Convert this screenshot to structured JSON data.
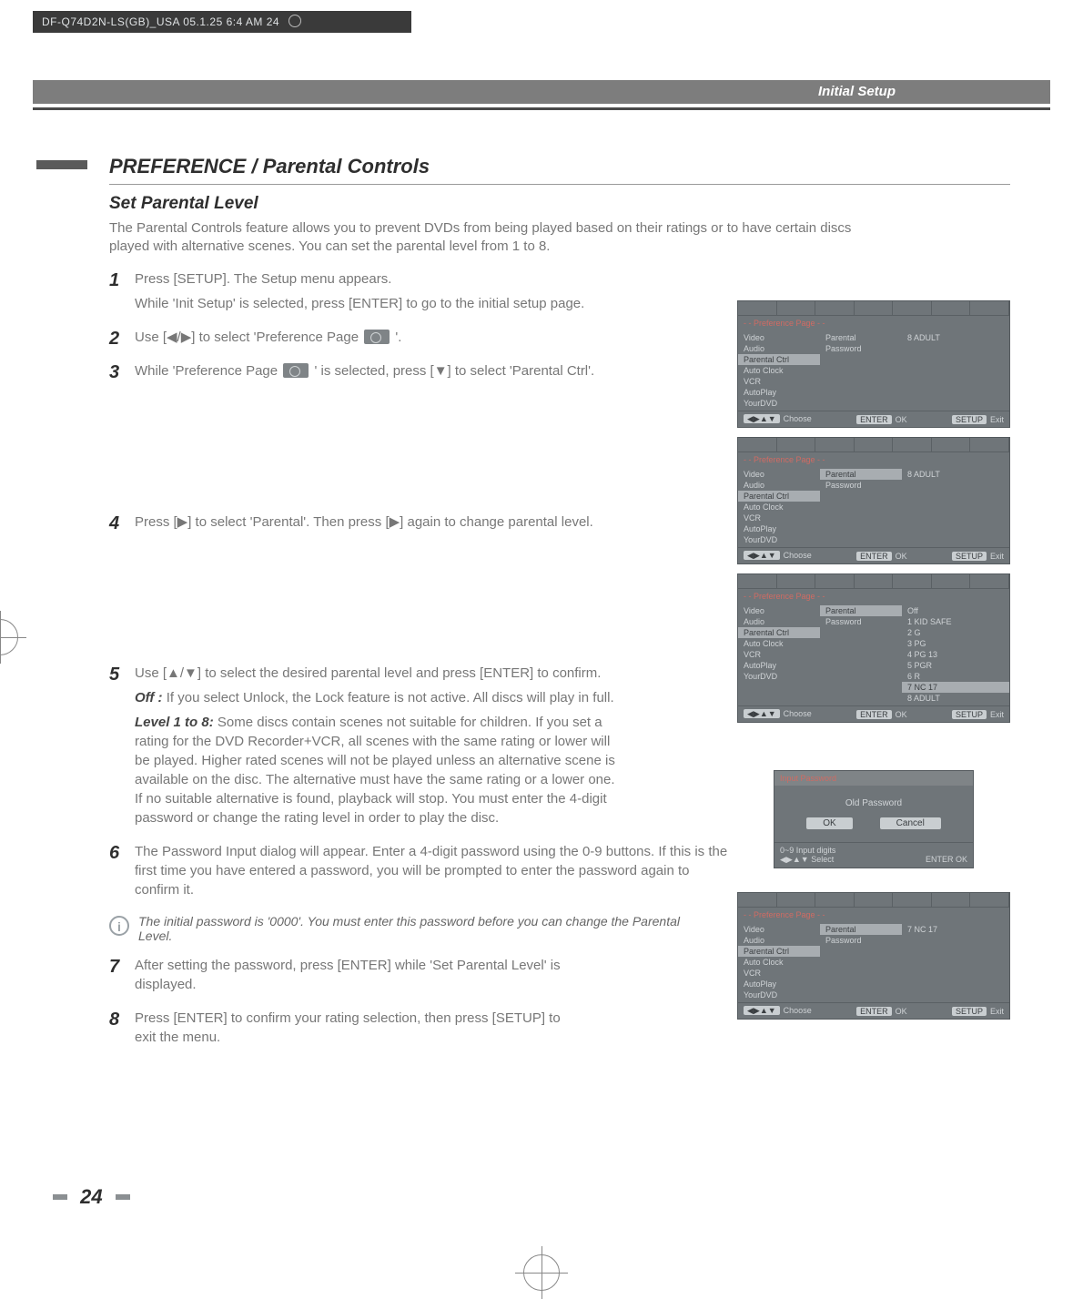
{
  "print_header": "DF-Q74D2N-LS(GB)_USA  05.1.25 6:4 AM      24",
  "section_label": "Initial Setup",
  "page_title": "PREFERENCE / Parental Controls",
  "subhead": "Set Parental Level",
  "intro": "The Parental Controls feature allows you to prevent DVDs from being played based on their ratings or to have certain discs played with alternative scenes. You can set the parental level from 1 to 8.",
  "steps": {
    "s1_a": "Press [SETUP].  The Setup menu appears.",
    "s1_b": "While 'Init Setup' is selected, press [ENTER] to go to the initial setup page.",
    "s2_a": "Use [◀/▶] to select 'Preference Page ",
    "s2_b": "'.",
    "s3_a": "While 'Preference Page ",
    "s3_b": "' is selected, press [▼] to select 'Parental Ctrl'.",
    "s4": "Press [▶] to select 'Parental'. Then press [▶] again to change parental level.",
    "s5": "Use [▲/▼] to select the desired parental level and press [ENTER] to confirm.",
    "s5_off_label": "Off :",
    "s5_off": " If you select Unlock, the Lock feature is not active. All discs will play in full.",
    "s5_lvl_label": "Level 1 to 8:",
    "s5_lvl": " Some discs contain scenes not suitable for children. If you set a rating for the DVD Recorder+VCR, all scenes with the same rating or lower will be played. Higher rated scenes will not be played unless an alternative scene is available on the disc. The alternative must have the same rating or a lower one. If no suitable alternative is found, playback will stop. You must enter the 4-digit password or change the rating level in order to play the disc.",
    "s6": "The Password Input dialog will appear. Enter a 4-digit password using the 0-9 buttons. If this is the first time you have entered a password, you will be prompted to enter the password again to confirm it.",
    "info": "The initial password is '0000'. You must enter this password before you can change the Parental Level.",
    "s7": "After setting the password, press [ENTER] while 'Set Parental Level' is displayed.",
    "s8": "Press [ENTER] to confirm your rating selection, then press [SETUP] to exit the menu."
  },
  "page_number": "24",
  "osd": {
    "crumb": "- - Preference Page - -",
    "left_menu": [
      "Video",
      "Audio",
      "Parental Ctrl",
      "Auto Clock",
      "VCR",
      "AutoPlay",
      "YourDVD"
    ],
    "mid_menu": [
      "Parental",
      "Password"
    ],
    "value_8": "8 ADULT",
    "value_7": "7 NC 17",
    "levels": [
      "Off",
      "1 KID SAFE",
      "2 G",
      "3 PG",
      "4 PG 13",
      "5 PGR",
      "6 R",
      "7 NC 17",
      "8 ADULT"
    ],
    "foot_choose": "Choose",
    "foot_ok": "OK",
    "foot_exit": "Exit",
    "btn_enter": "ENTER",
    "btn_setup": "SETUP",
    "arrows": "◀▶▲▼"
  },
  "pw": {
    "title": "Input Password",
    "old": "Old Password",
    "ok": "OK",
    "cancel": "Cancel",
    "hint1": "Input digits",
    "hint2": "Select",
    "foot_ok": "OK",
    "key_09": "0~9"
  }
}
